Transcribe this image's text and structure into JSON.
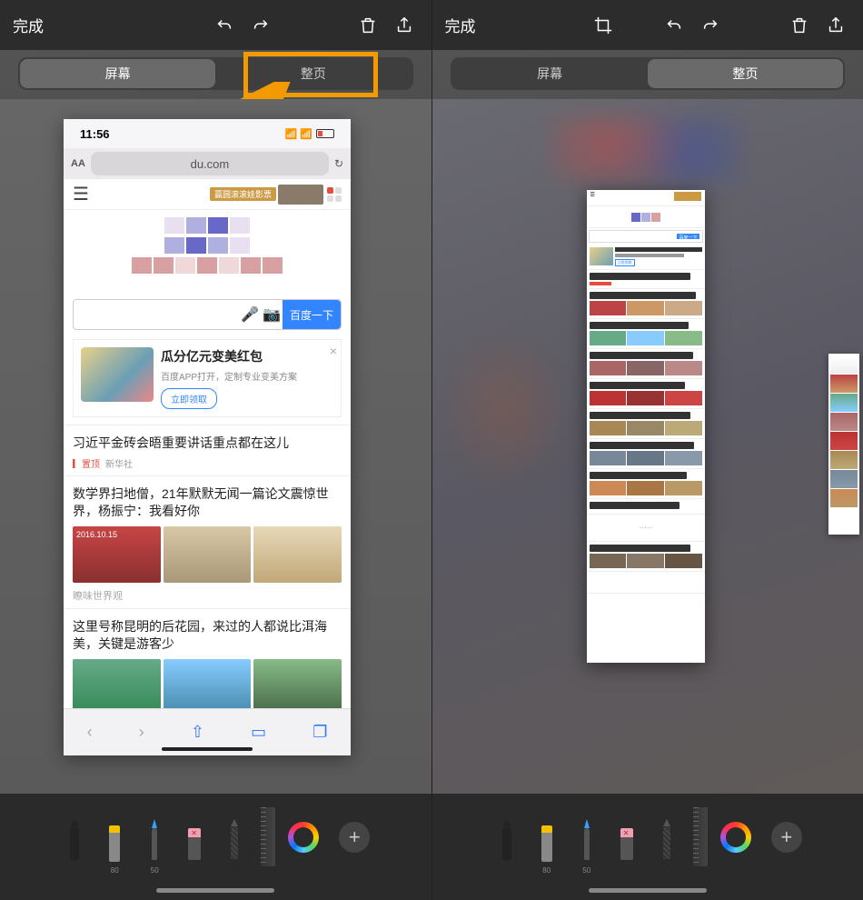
{
  "header": {
    "done": "完成",
    "undo_icon": "undo-icon",
    "redo_icon": "redo-icon",
    "crop_icon": "crop-icon",
    "trash_icon": "trash-icon",
    "share_icon": "share-icon"
  },
  "tabs": {
    "screen": "屏幕",
    "fullpage": "整页"
  },
  "phone": {
    "time": "11:56",
    "url_host": "du.com",
    "text_size": "AA",
    "banner_ad": "赢圆滚滚娃影票",
    "search_button": "百度一下",
    "promo": {
      "title": "瓜分亿元变美红包",
      "subtitle": "百度APP打开，定制专业变美方案",
      "cta": "立即领取"
    },
    "news": [
      {
        "title": "习近平金砖会晤重要讲话重点都在这儿",
        "pin": "置顶",
        "source": "新华社"
      },
      {
        "title": "数学界扫地僧，21年默默无闻一篇论文震惊世界，杨振宁：我看好你",
        "label": "瞭味世界观"
      },
      {
        "title": "这里号称昆明的后花园，来过的人都说比洱海美，关键是游客少"
      }
    ]
  },
  "toolbar": {
    "labels": [
      "80",
      "50"
    ]
  },
  "colors": {
    "highlight": "#f29a00",
    "accent_blue": "#3478f6"
  }
}
